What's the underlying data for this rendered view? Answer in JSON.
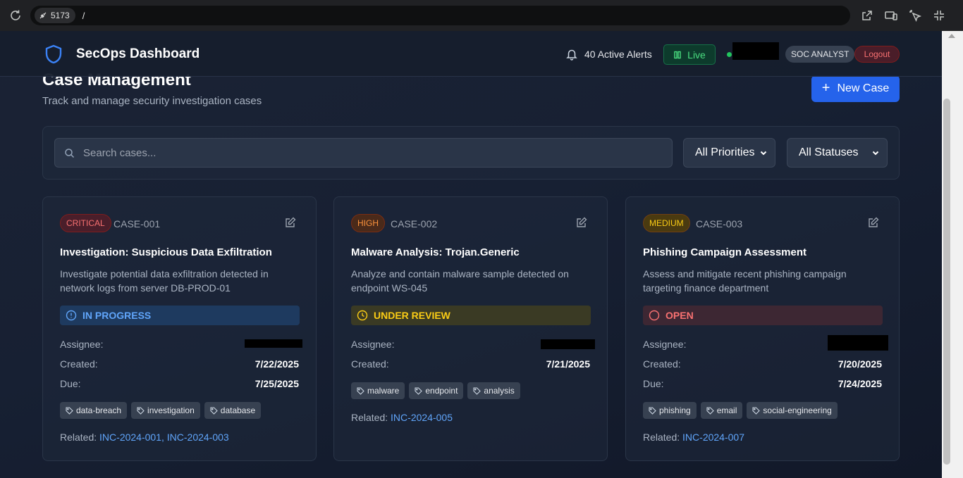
{
  "browser": {
    "port": "5173",
    "path": "/"
  },
  "header": {
    "app_title": "SecOps Dashboard",
    "alerts_text": "40 Active Alerts",
    "live_label": "Live",
    "role": "SOC ANALYST",
    "logout_label": "Logout"
  },
  "page": {
    "title": "Case Management",
    "subtitle": "Track and manage security investigation cases",
    "new_case_label": "New Case"
  },
  "filters": {
    "search_placeholder": "Search cases...",
    "priority": "All Priorities",
    "status": "All Statuses"
  },
  "labels": {
    "assignee": "Assignee:",
    "created": "Created:",
    "due": "Due:",
    "related": "Related:"
  },
  "cases": [
    {
      "priority": "CRITICAL",
      "id": "CASE-001",
      "title": "Investigation: Suspicious Data Exfiltration",
      "description": "Investigate potential data exfiltration detected in network logs from server DB-PROD-01",
      "status": "IN PROGRESS",
      "created": "7/22/2025",
      "due": "7/25/2025",
      "tags": [
        "data-breach",
        "investigation",
        "database"
      ],
      "related": "INC-2024-001, INC-2024-003"
    },
    {
      "priority": "HIGH",
      "id": "CASE-002",
      "title": "Malware Analysis: Trojan.Generic",
      "description": "Analyze and contain malware sample detected on endpoint WS-045",
      "status": "UNDER REVIEW",
      "created": "7/21/2025",
      "tags": [
        "malware",
        "endpoint",
        "analysis"
      ],
      "related": "INC-2024-005"
    },
    {
      "priority": "MEDIUM",
      "id": "CASE-003",
      "title": "Phishing Campaign Assessment",
      "description": "Assess and mitigate recent phishing campaign targeting finance department",
      "status": "OPEN",
      "created": "7/20/2025",
      "due": "7/24/2025",
      "tags": [
        "phishing",
        "email",
        "social-engineering"
      ],
      "related": "INC-2024-007"
    }
  ],
  "colors": {
    "accent": "#2563eb",
    "critical": "#f87171",
    "high": "#fb923c",
    "medium": "#facc15",
    "live": "#4ade80"
  }
}
